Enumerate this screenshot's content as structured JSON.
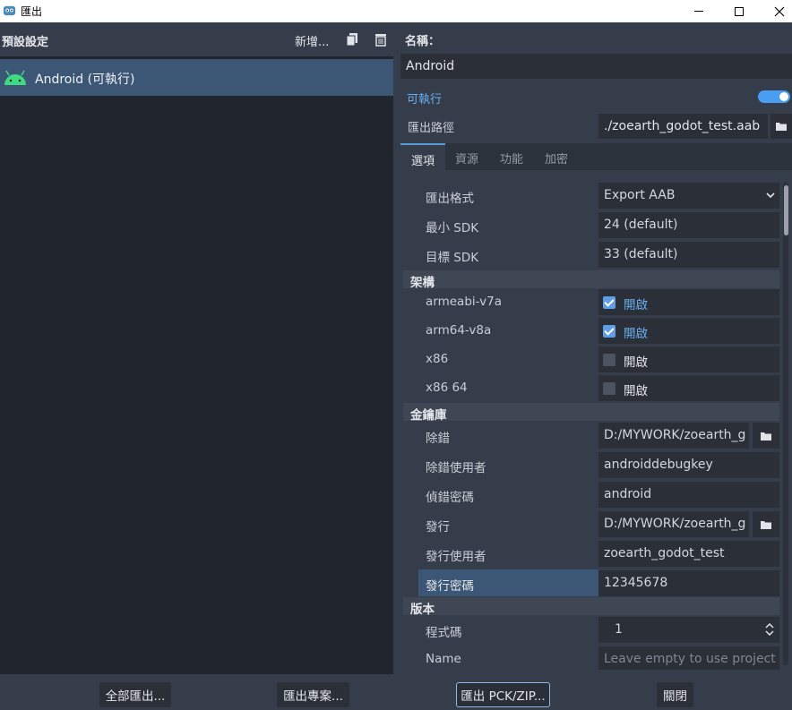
{
  "window": {
    "title": "匯出"
  },
  "presets": {
    "header": "預設設定",
    "add_label": "新增...",
    "items": [
      {
        "label": "Android (可執行)"
      }
    ]
  },
  "details": {
    "name_label": "名稱：",
    "name_value": "Android",
    "runnable_label": "可執行",
    "runnable_on": true,
    "export_path_label": "匯出路徑",
    "export_path_value": "./zoearth_godot_test.aab",
    "tabs": [
      {
        "label": "選項",
        "active": true
      },
      {
        "label": "資源",
        "active": false
      },
      {
        "label": "功能",
        "active": false
      },
      {
        "label": "加密",
        "active": false
      }
    ]
  },
  "options": {
    "export_format": {
      "label": "匯出格式",
      "value": "Export AAB"
    },
    "min_sdk": {
      "label": "最小 SDK",
      "value": "24 (default)"
    },
    "target_sdk": {
      "label": "目標 SDK",
      "value": "33 (default)"
    },
    "architectures": {
      "section": "架構",
      "items": [
        {
          "label": "armeabi-v7a",
          "checked": true,
          "value": "開啟"
        },
        {
          "label": "arm64-v8a",
          "checked": true,
          "value": "開啟"
        },
        {
          "label": "x86",
          "checked": false,
          "value": "開啟"
        },
        {
          "label": "x86 64",
          "checked": false,
          "value": "開啟"
        }
      ]
    },
    "keystore": {
      "section": "金鑰庫",
      "debug": {
        "label": "除錯",
        "value": "D:/MYWORK/zoearth_g"
      },
      "debug_user": {
        "label": "除錯使用者",
        "value": "androiddebugkey"
      },
      "debug_password": {
        "label": "偵錯密碼",
        "value": "android"
      },
      "release": {
        "label": "發行",
        "value": "D:/MYWORK/zoearth_g"
      },
      "release_user": {
        "label": "發行使用者",
        "value": "zoearth_godot_test"
      },
      "release_password": {
        "label": "發行密碼",
        "value": "12345678"
      }
    },
    "version": {
      "section": "版本",
      "code": {
        "label": "程式碼",
        "value": "1"
      },
      "name": {
        "label": "Name",
        "placeholder": "Leave empty to use project v"
      }
    }
  },
  "footer": {
    "export_all": "全部匯出...",
    "export_project": "匯出專案...",
    "export_pck": "匯出 PCK/ZIP...",
    "close": "關閉"
  },
  "colors": {
    "accent": "#69b0f0",
    "selection": "#3c5775",
    "toggle": "#4a9df0"
  }
}
